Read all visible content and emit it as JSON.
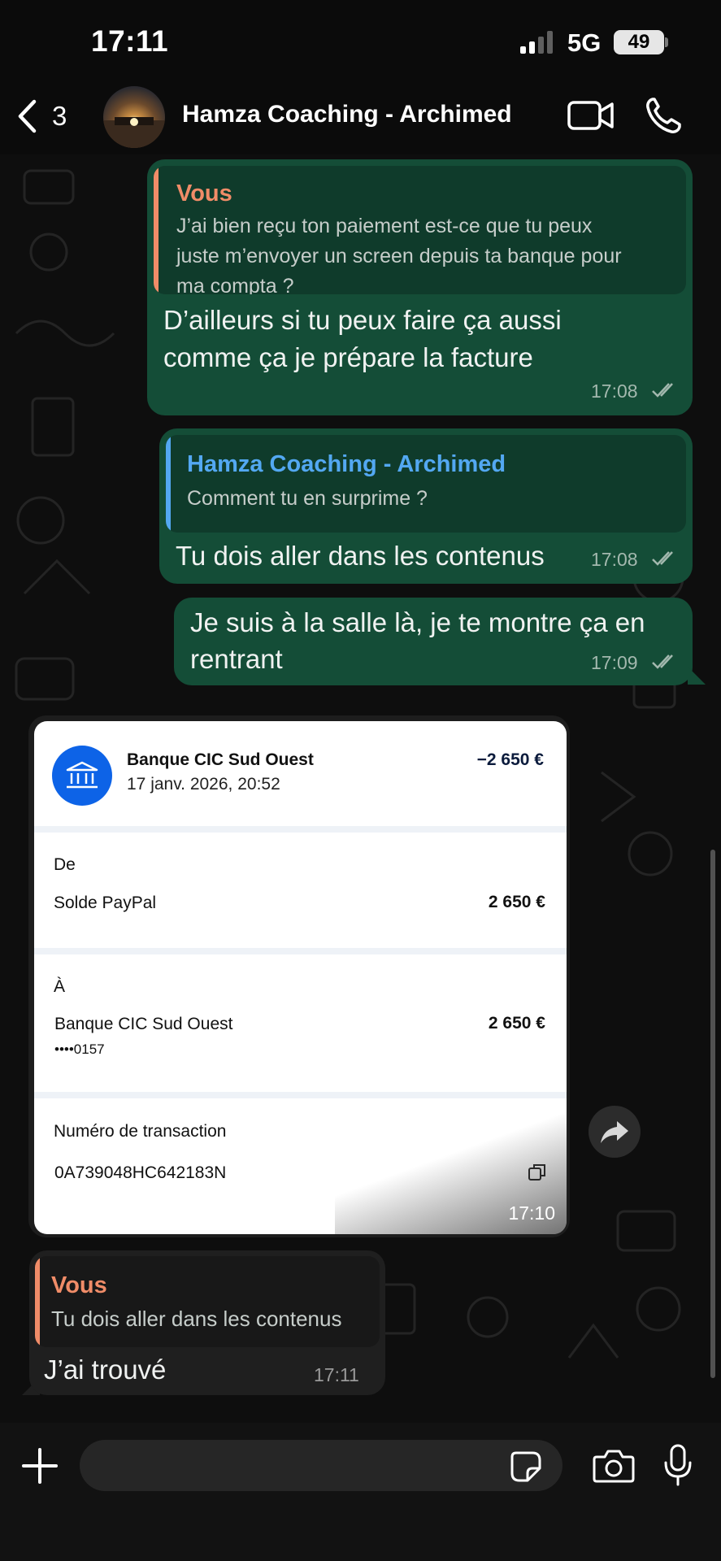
{
  "status_bar": {
    "time": "17:11",
    "network": "5G",
    "battery": "49"
  },
  "header": {
    "back_count": "3",
    "title": "Hamza Coaching - Archimed",
    "icons": {
      "back": "chevron-left-icon",
      "video": "video-camera-icon",
      "call": "phone-icon"
    }
  },
  "colors": {
    "outgoing_bubble": "#144d37",
    "incoming_bubble": "#1f1f1f",
    "quote_you": "#f08c68",
    "quote_contact": "#53a8f2",
    "bank_blue": "#0d63e7"
  },
  "messages": [
    {
      "direction": "out",
      "quote": {
        "author": "Vous",
        "text_lines": [
          "J’ai bien reçu ton paiement est-ce que tu peux",
          "juste m’envoyer un screen depuis ta banque pour",
          "ma compta ?"
        ]
      },
      "text_lines": [
        "D’ailleurs si tu peux faire ça aussi",
        "comme ça je prépare la facture"
      ],
      "time": "17:08",
      "status": "read"
    },
    {
      "direction": "out",
      "quote": {
        "author": "Hamza Coaching - Archimed",
        "text_lines": [
          "Comment tu en surprime ?"
        ]
      },
      "text_lines": [
        "Tu dois aller dans les contenus"
      ],
      "time": "17:08",
      "status": "read"
    },
    {
      "direction": "out",
      "text_lines": [
        "Je suis à la salle là, je te montre ça en",
        "rentrant"
      ],
      "time": "17:09",
      "status": "read"
    },
    {
      "direction": "in",
      "type": "image",
      "time": "17:10",
      "receipt": {
        "bank_name": "Banque CIC Sud Ouest",
        "date": "17 janv. 2026, 20:52",
        "amount": "−2 650 €",
        "from_label": "De",
        "from_value": "Solde PayPal",
        "from_amount": "2 650 €",
        "to_label": "À",
        "to_value": "Banque CIC Sud Ouest",
        "to_account": "••••0157",
        "to_amount": "2 650 €",
        "transaction_label": "Numéro de transaction",
        "transaction_id": "0A739048HC642183N"
      }
    },
    {
      "direction": "in",
      "quote": {
        "author": "Vous",
        "text_lines": [
          "Tu dois aller dans les contenus"
        ]
      },
      "text_lines": [
        "J’ai trouvé"
      ],
      "time": "17:11"
    }
  ],
  "input": {
    "placeholder": "",
    "value": ""
  }
}
